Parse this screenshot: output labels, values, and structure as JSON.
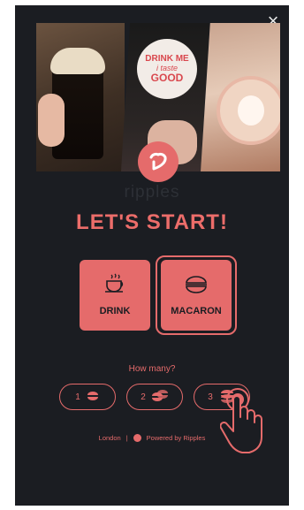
{
  "hero": {
    "cup_text": [
      "DRINK ME",
      "i taste",
      "GOOD"
    ]
  },
  "brand": {
    "name": "ripples"
  },
  "title": "LET'S START!",
  "options": [
    {
      "label": "DRINK",
      "icon": "coffee-cup-icon"
    },
    {
      "label": "MACARON",
      "icon": "macaron-icon"
    }
  ],
  "quantity": {
    "prompt": "How many?",
    "choices": [
      "1",
      "2",
      "3"
    ]
  },
  "footer": {
    "location": "London",
    "separator": "|",
    "powered": "Powered by Ripples"
  },
  "colors": {
    "accent": "#e56b6b",
    "background": "#1b1d22",
    "brand_text": "#2d3036"
  }
}
